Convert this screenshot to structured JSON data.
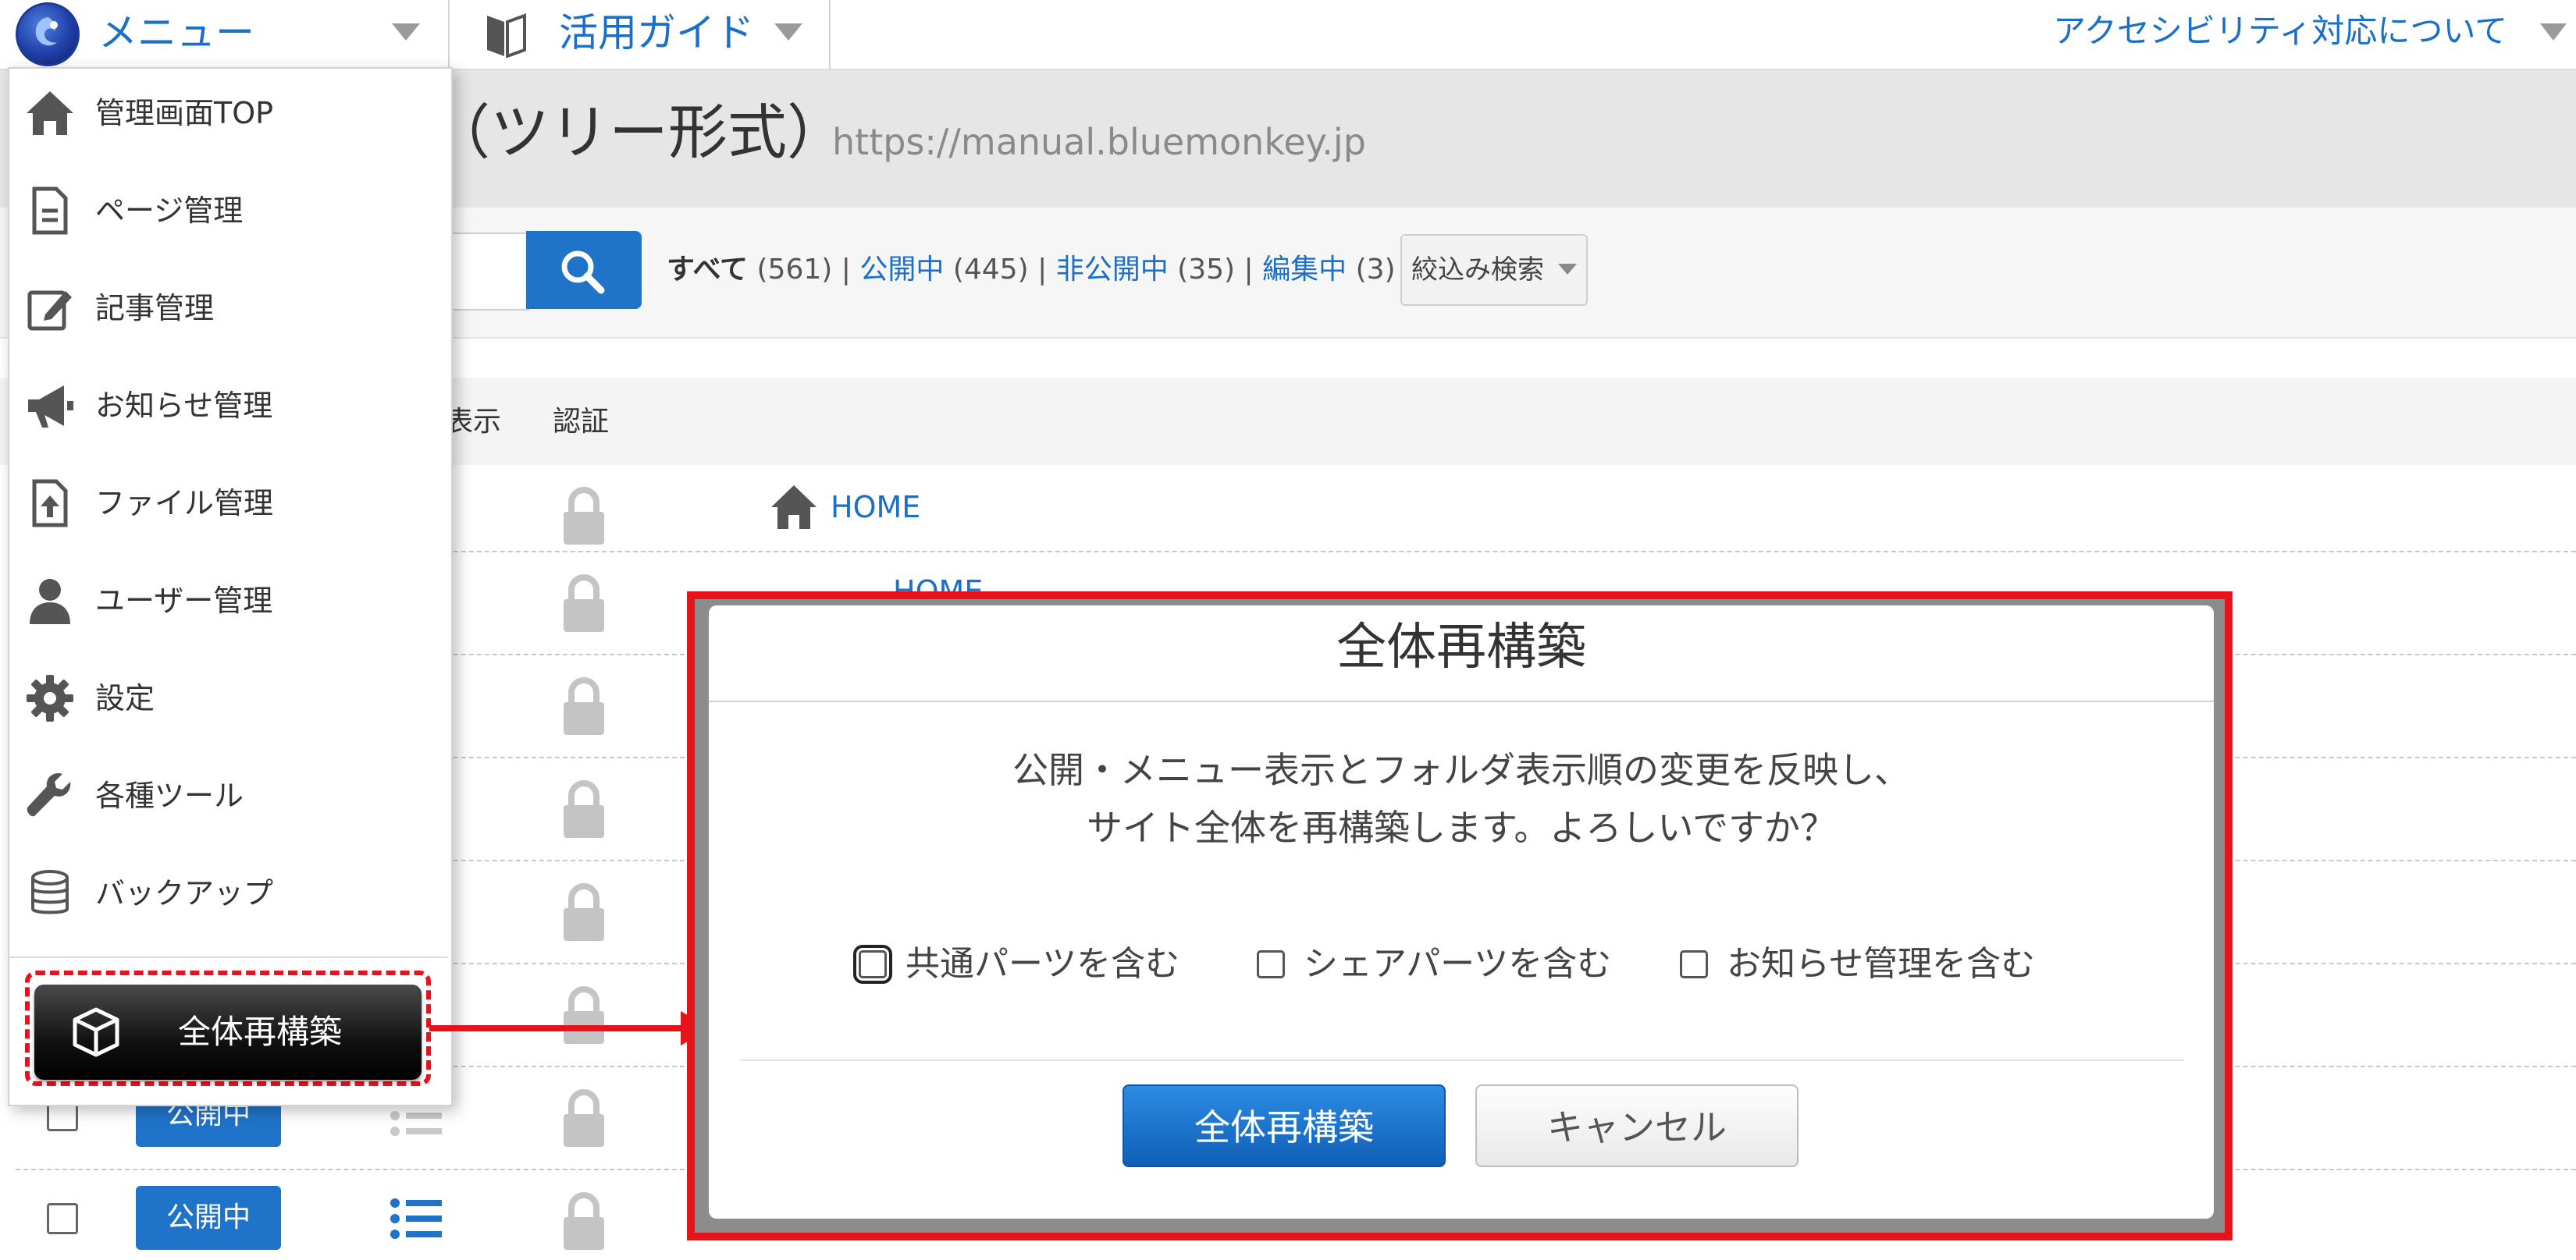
{
  "topbar": {
    "menu_label": "メニュー",
    "guide_label": "活用ガイド",
    "accessibility_label": "アクセシビリティ対応について"
  },
  "page": {
    "title": "（ツリー形式）",
    "url": "https://manual.bluemonkey.jp"
  },
  "filters": {
    "all_label": "すべて",
    "all_count": "(561)",
    "public_label": "公開中",
    "public_count": "(445)",
    "private_label": "非公開中",
    "private_count": "(35)",
    "editing_label": "編集中",
    "editing_count": "(3)",
    "separator": "|",
    "narrow_search": "絞込み検索"
  },
  "columns": {
    "display": "表示",
    "auth": "認証"
  },
  "tree": {
    "home": "HOME",
    "home_sub": "HOME"
  },
  "rows": {
    "status_1": "公開中",
    "status_2": "公開中"
  },
  "menu": {
    "items": [
      {
        "label": "管理画面TOP",
        "icon": "home-icon"
      },
      {
        "label": "ページ管理",
        "icon": "page-icon"
      },
      {
        "label": "記事管理",
        "icon": "edit-icon"
      },
      {
        "label": "お知らせ管理",
        "icon": "megaphone-icon"
      },
      {
        "label": "ファイル管理",
        "icon": "file-upload-icon"
      },
      {
        "label": "ユーザー管理",
        "icon": "user-icon"
      },
      {
        "label": "設定",
        "icon": "gear-icon"
      },
      {
        "label": "各種ツール",
        "icon": "wrench-icon"
      },
      {
        "label": "バックアップ",
        "icon": "database-icon"
      }
    ],
    "rebuild_label": "全体再構築"
  },
  "modal": {
    "title": "全体再構築",
    "message_line1": "公開・メニュー表示とフォルダ表示順の変更を反映し、",
    "message_line2": "サイト全体を再構築します。よろしいですか？",
    "options": [
      "共通パーツを含む",
      "シェアパーツを含む",
      "お知らせ管理を含む"
    ],
    "ok_label": "全体再構築",
    "cancel_label": "キャンセル"
  },
  "colors": {
    "link_blue": "#1a6fc9",
    "primary_button": "#1f73c9",
    "highlight_red": "#e8121b"
  }
}
